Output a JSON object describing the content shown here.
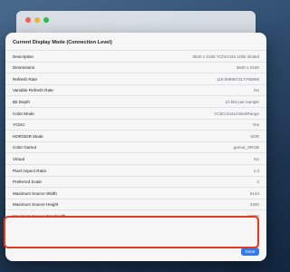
{
  "panel": {
    "title": "Current Display Mode (Connection Level)",
    "done_label": "Done"
  },
  "rows": [
    {
      "label": "Description",
      "value": "3840 x 2160 YCbCr444 10bit limited"
    },
    {
      "label": "Dimensions",
      "value": "3840 x 2160"
    },
    {
      "label": "Refresh Rate",
      "value": "119.999997317790999"
    },
    {
      "label": "Variable Refresh Rate",
      "value": "No"
    },
    {
      "label": "Bit Depth",
      "value": "10 bits per sample"
    },
    {
      "label": "Color Mode",
      "value": "YCbCr444LimitedRange"
    },
    {
      "label": "YCbCr",
      "value": "Yes"
    },
    {
      "label": "HDR/SDR Mode",
      "value": "SDR"
    },
    {
      "label": "Color Gamut",
      "value": "gamut_SRGB"
    },
    {
      "label": "Virtual",
      "value": "No"
    },
    {
      "label": "Pixel Aspect Ratio",
      "value": "1.0"
    },
    {
      "label": "Preferred Scale",
      "value": "2"
    },
    {
      "label": "Maximum Source Width",
      "value": "6144"
    },
    {
      "label": "Maximum Source Height",
      "value": "4320"
    },
    {
      "label": "Maximum Source Bandwidth",
      "value": "13700"
    }
  ],
  "colors": {
    "accent": "#2f7bf6",
    "highlight": "#e5391e"
  }
}
